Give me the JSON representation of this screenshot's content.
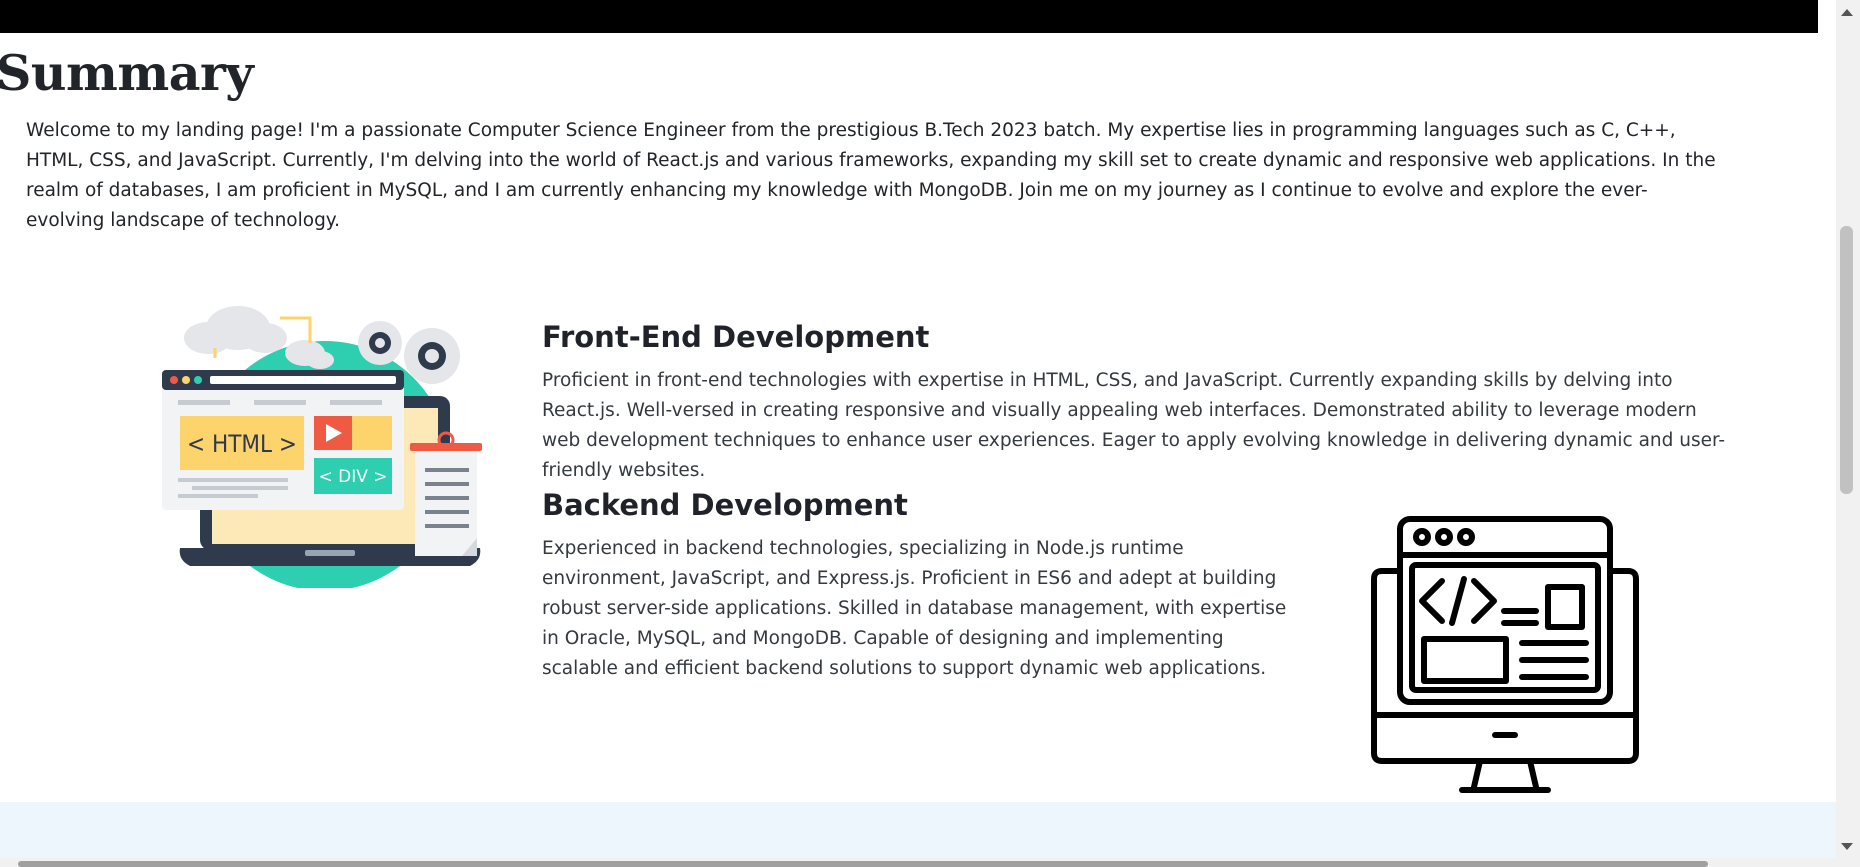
{
  "summary": {
    "title": "Summary",
    "text": "Welcome to my landing page! I'm a passionate Computer Science Engineer from the prestigious B.Tech 2023 batch. My expertise lies in programming languages such as C, C++, HTML, CSS, and JavaScript. Currently, I'm delving into the world of React.js and various frameworks, expanding my skill set to create dynamic and responsive web applications. In the realm of databases, I am proficient in MySQL, and I am currently enhancing my knowledge with MongoDB. Join me on my journey as I continue to evolve and explore the ever-evolving landscape of technology."
  },
  "frontend": {
    "title": "Front-End Development",
    "text": "Proficient in front-end technologies with expertise in HTML, CSS, and JavaScript. Currently expanding skills by delving into React.js. Well-versed in creating responsive and visually appealing web interfaces. Demonstrated ability to leverage modern web development techniques to enhance user experiences. Eager to apply evolving knowledge in delivering dynamic and user-friendly websites.",
    "illustration_labels": {
      "html": "< HTML >",
      "div": "< DIV >"
    },
    "illustration_icon": "web-development-illustration-icon"
  },
  "backend": {
    "title": "Backend Development",
    "text": "Experienced in backend technologies, specializing in Node.js runtime environment, JavaScript, and Express.js. Proficient in ES6 and adept at building robust server-side applications. Skilled in database management, with expertise in Oracle, MySQL, and MongoDB. Capable of designing and implementing scalable and efficient backend solutions to support dynamic web applications.",
    "illustration_icon": "code-monitor-icon"
  },
  "colors": {
    "teal": "#2dcfb0",
    "yellow": "#fdd36b",
    "dark": "#2f3a4c",
    "red": "#ef5a45",
    "band": "#eef6fd"
  }
}
